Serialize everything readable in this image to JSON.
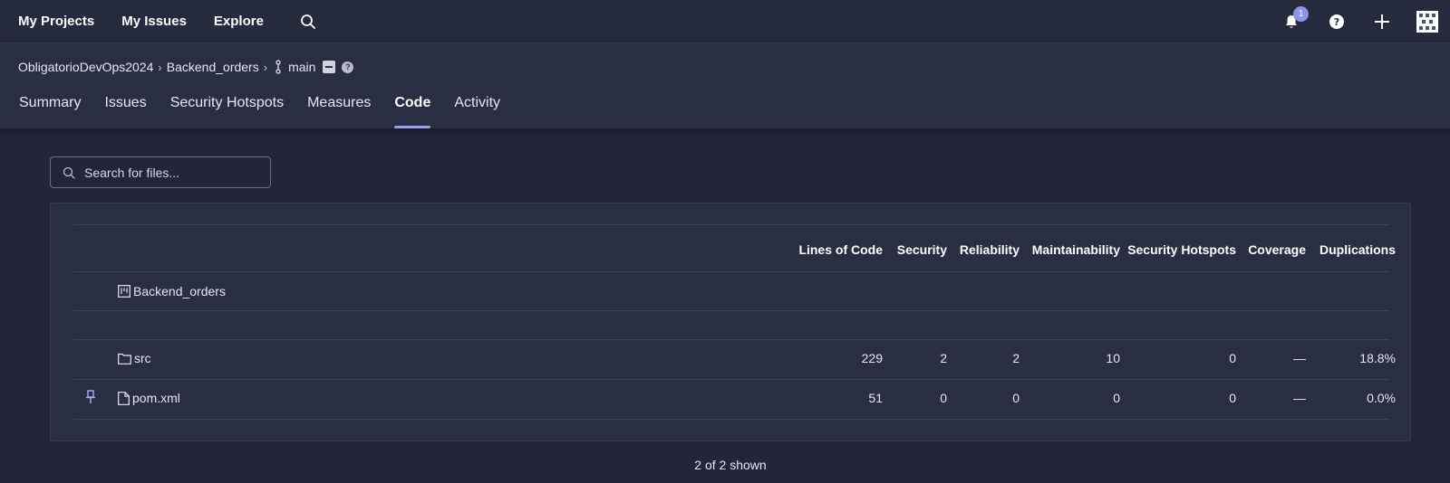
{
  "topnav": {
    "links": [
      "My Projects",
      "My Issues",
      "Explore"
    ],
    "notifications_count": "1"
  },
  "breadcrumb": {
    "organization": "ObligatorioDevOps2024",
    "project": "Backend_orders",
    "branch": "main"
  },
  "tabs": [
    "Summary",
    "Issues",
    "Security Hotspots",
    "Measures",
    "Code",
    "Activity"
  ],
  "active_tab": "Code",
  "search": {
    "placeholder": "Search for files..."
  },
  "table": {
    "columns": [
      "Lines of Code",
      "Security",
      "Reliability",
      "Maintainability",
      "Security Hotspots",
      "Coverage",
      "Duplications"
    ],
    "root": "Backend_orders",
    "rows": [
      {
        "name": "src",
        "type": "folder",
        "values": [
          "229",
          "2",
          "2",
          "10",
          "0",
          "—",
          "18.8%"
        ]
      },
      {
        "name": "pom.xml",
        "type": "file",
        "values": [
          "51",
          "0",
          "0",
          "0",
          "0",
          "—",
          "0.0%"
        ]
      }
    ]
  },
  "footer": {
    "shown": "2 of 2 shown"
  },
  "colors": {
    "accent": "#9aa0ee",
    "background": "#23263a",
    "panel": "#2a2e42"
  }
}
